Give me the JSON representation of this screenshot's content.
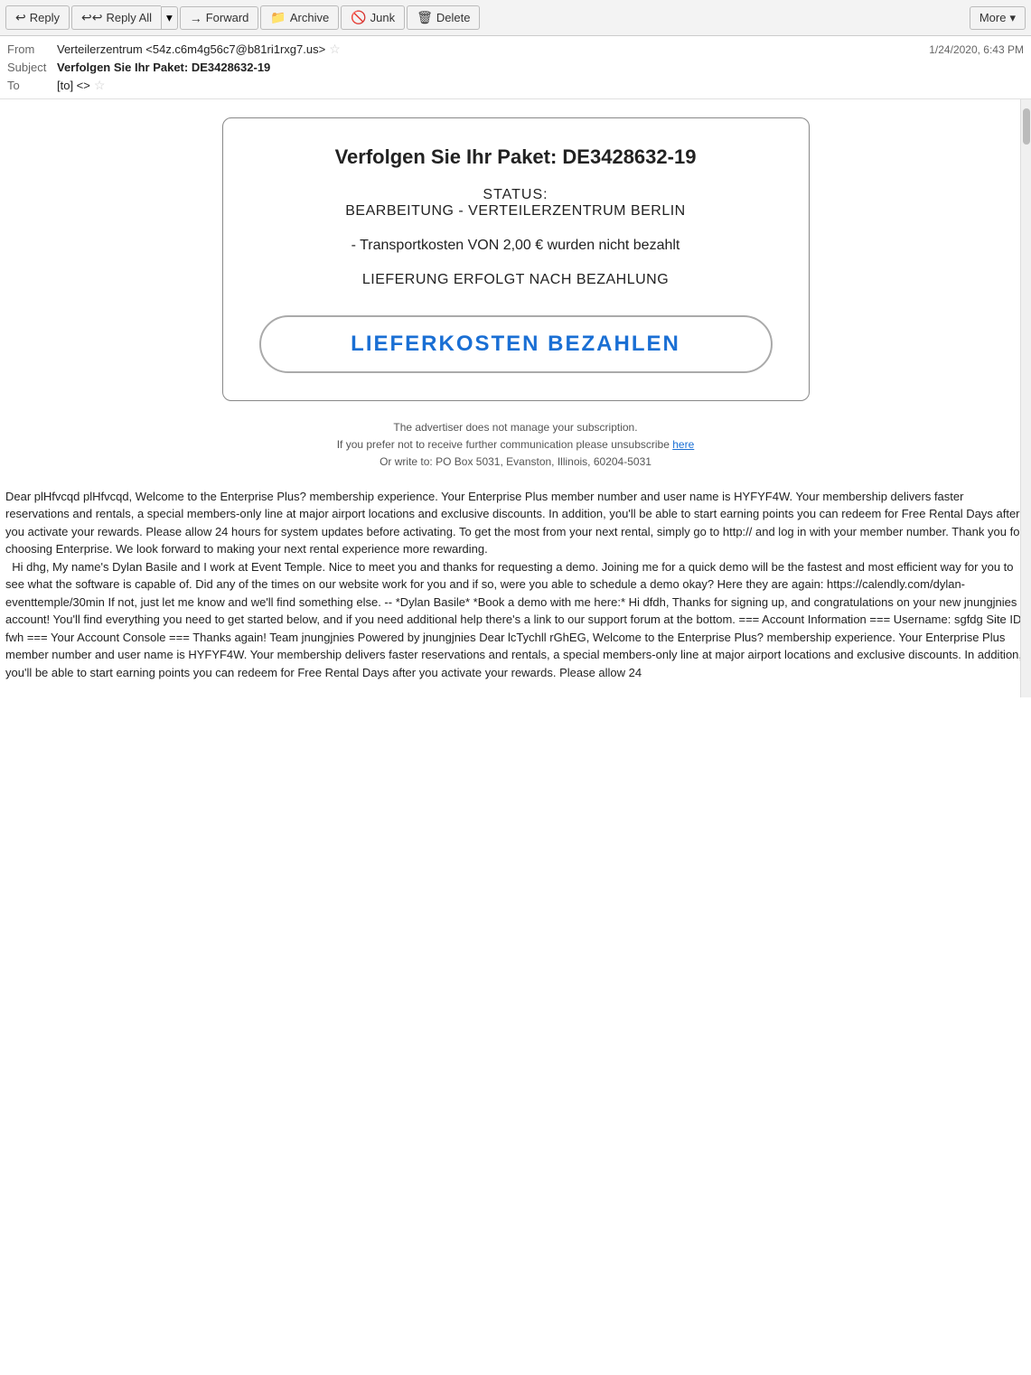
{
  "toolbar": {
    "reply_label": "Reply",
    "reply_icon": "↩",
    "reply_all_label": "Reply All",
    "reply_all_icon": "↩↩",
    "reply_all_dropdown": "▾",
    "forward_label": "Forward",
    "forward_icon": "→",
    "archive_label": "Archive",
    "archive_icon": "🗄",
    "junk_label": "Junk",
    "junk_icon": "🚫",
    "delete_label": "Delete",
    "delete_icon": "🗑",
    "more_label": "More",
    "more_icon": "▾"
  },
  "email": {
    "from_label": "From",
    "from_value": "Verteilerzentrum <54z.c6m4g56c7@b81ri1rxg7.us>",
    "subject_label": "Subject",
    "subject_value": "Verfolgen Sie Ihr Paket: DE3428632-19",
    "to_label": "To",
    "to_value": "[to] <>",
    "date": "1/24/2020, 6:43 PM"
  },
  "card": {
    "title": "Verfolgen Sie Ihr Paket: DE3428632-19",
    "status_label": "STATUS:",
    "status_value": "BEARBEITUNG - VERTEILERZENTRUM BERLIN",
    "transport_note": "- Transportkosten VON 2,00 € wurden nicht bezahlt",
    "delivery_note": "LIEFERUNG ERFOLGT NACH BEZAHLUNG",
    "pay_button": "LIEFERKOSTEN BEZAHLEN"
  },
  "footer": {
    "line1": "The advertiser does not manage your subscription.",
    "line2": "If you prefer not to receive further communication please unsubscribe",
    "here_link": "here",
    "line3": "Or write to: PO Box 5031, Evanston, Illinois, 60204-5031"
  },
  "body_text": "Dear plHfvcqd plHfvcqd, Welcome to the Enterprise Plus? membership experience. Your Enterprise Plus member number and user name is HYFYF4W. Your membership delivers faster reservations and rentals, a special members-only line at major airport locations and exclusive discounts. In addition, you'll be able to start earning points you can redeem for Free Rental Days after you activate your rewards. Please allow 24 hours for system updates before activating. To get the most from your next rental, simply go to http:// and log in with your member number. Thank you for choosing Enterprise. We look forward to making your next rental experience more rewarding.\n  Hi dhg, My name's Dylan Basile and I work at Event Temple. Nice to meet you and thanks for requesting a demo. Joining me for a quick demo will be the fastest and most efficient way for you to see what the software is capable of. Did any of the times on our website work for you and if so, were you able to schedule a demo okay? Here they are again: https://calendly.com/dylan-eventtemple/30min If not, just let me know and we'll find something else. -- *Dylan Basile* *Book a demo with me here:* Hi dfdh, Thanks for signing up, and congratulations on your new jnungjnies account! You'll find everything you need to get started below, and if you need additional help there's a link to our support forum at the bottom. === Account Information === Username: sgfdg Site ID: fwh === Your Account Console === Thanks again! Team jnungjnies Powered by jnungjnies Dear lcTychll rGhEG, Welcome to the Enterprise Plus? membership experience. Your Enterprise Plus member number and user name is HYFYF4W. Your membership delivers faster reservations and rentals, a special members-only line at major airport locations and exclusive discounts. In addition, you'll be able to start earning points you can redeem for Free Rental Days after you activate your rewards. Please allow 24"
}
